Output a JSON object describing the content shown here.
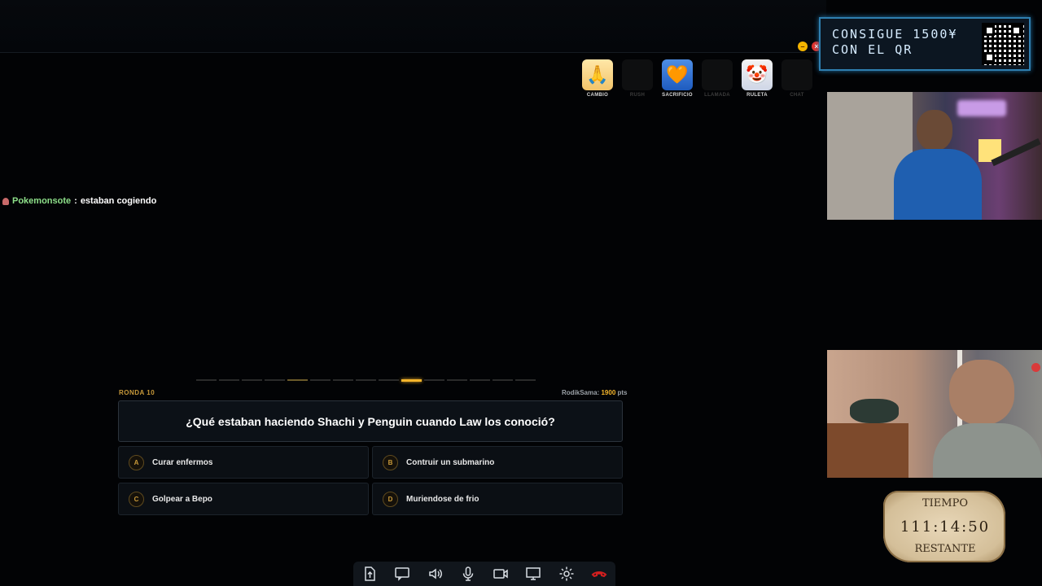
{
  "powerups": [
    {
      "label": "CAMBIO",
      "icon": "cambio-icon",
      "active": true
    },
    {
      "label": "RUSH",
      "icon": "rush-icon",
      "active": false
    },
    {
      "label": "SACRIFICIO",
      "icon": "sacrificio-icon",
      "active": true
    },
    {
      "label": "LLAMADA",
      "icon": "llamada-icon",
      "active": false
    },
    {
      "label": "RULETA",
      "icon": "ruleta-icon",
      "active": true
    },
    {
      "label": "CHAT",
      "icon": "chat-icon",
      "active": false
    }
  ],
  "chat": {
    "user": "Pokemonsote",
    "separator": ":",
    "message": "estaban cogiendo"
  },
  "quiz": {
    "round": "RONDA 10",
    "player": "RodikSama:",
    "points": "1900",
    "points_unit": "pts",
    "question": "¿Qué estaban haciendo Shachi y Penguin cuando Law los conoció?",
    "answers": [
      {
        "letter": "A",
        "text": "Curar enfermos"
      },
      {
        "letter": "B",
        "text": "Contruir un submarino"
      },
      {
        "letter": "C",
        "text": "Golpear a Bepo"
      },
      {
        "letter": "D",
        "text": "Muriendose de frio"
      }
    ]
  },
  "banner": {
    "line1": "CONSIGUE 1500¥",
    "line2": "CON EL QR"
  },
  "timer": {
    "top": "TIEMPO",
    "value": "111:14:50",
    "bottom": "RESTANTE"
  },
  "colors": {
    "accent": "#f5b52b",
    "banner_border": "#2f7fb0",
    "chat_user": "#8ee08a",
    "hangup": "#d21f1f"
  }
}
